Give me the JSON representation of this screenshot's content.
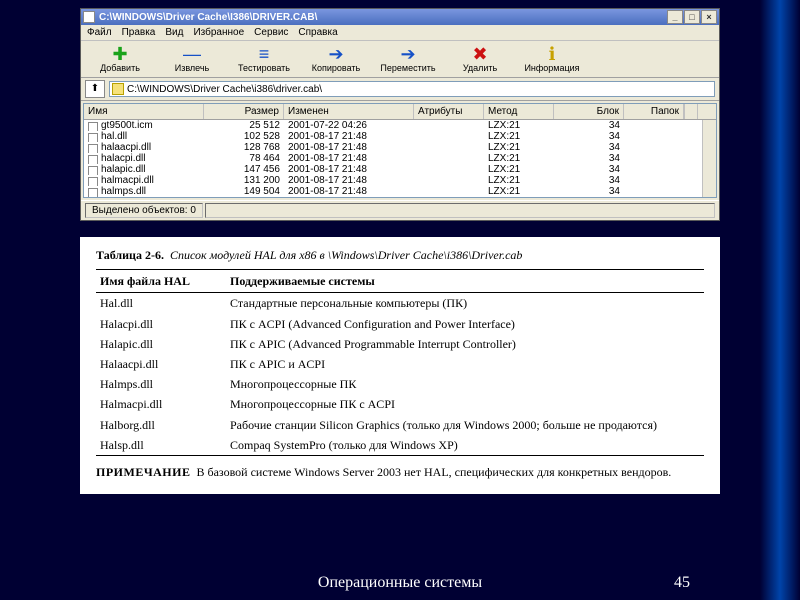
{
  "window": {
    "title": "C:\\WINDOWS\\Driver Cache\\I386\\DRIVER.CAB\\",
    "minimize": "_",
    "maximize": "□",
    "close": "×"
  },
  "menu": {
    "file": "Файл",
    "edit": "Правка",
    "view": "Вид",
    "favorites": "Избранное",
    "service": "Сервис",
    "help": "Справка"
  },
  "toolbar": {
    "add": {
      "label": "Добавить",
      "glyph": "✚",
      "color": "#1aa21a"
    },
    "extract": {
      "label": "Извлечь",
      "glyph": "—",
      "color": "#1651c7"
    },
    "test": {
      "label": "Тестировать",
      "glyph": "≡",
      "color": "#1651c7"
    },
    "copy": {
      "label": "Копировать",
      "glyph": "➔",
      "color": "#1651c7"
    },
    "move": {
      "label": "Переместить",
      "glyph": "➔",
      "color": "#1651c7"
    },
    "delete": {
      "label": "Удалить",
      "glyph": "✖",
      "color": "#cc1111"
    },
    "info": {
      "label": "Информация",
      "glyph": "ℹ",
      "color": "#c7a100"
    }
  },
  "address": {
    "up": "⬆",
    "path": "C:\\WINDOWS\\Driver Cache\\i386\\driver.cab\\"
  },
  "columns": {
    "name": "Имя",
    "size": "Размер",
    "modified": "Изменен",
    "attrs": "Атрибуты",
    "method": "Метод",
    "block": "Блок",
    "folders": "Папок"
  },
  "files": [
    {
      "name": "gt9500t.icm",
      "size": "25 512",
      "date": "2001-07-22 04:26",
      "attr": "",
      "method": "LZX:21",
      "block": "34",
      "fold": ""
    },
    {
      "name": "hal.dll",
      "size": "102 528",
      "date": "2001-08-17 21:48",
      "attr": "",
      "method": "LZX:21",
      "block": "34",
      "fold": ""
    },
    {
      "name": "halaacpi.dll",
      "size": "128 768",
      "date": "2001-08-17 21:48",
      "attr": "",
      "method": "LZX:21",
      "block": "34",
      "fold": ""
    },
    {
      "name": "halacpi.dll",
      "size": "78 464",
      "date": "2001-08-17 21:48",
      "attr": "",
      "method": "LZX:21",
      "block": "34",
      "fold": ""
    },
    {
      "name": "halapic.dll",
      "size": "147 456",
      "date": "2001-08-17 21:48",
      "attr": "",
      "method": "LZX:21",
      "block": "34",
      "fold": ""
    },
    {
      "name": "halmacpi.dll",
      "size": "131 200",
      "date": "2001-08-17 21:48",
      "attr": "",
      "method": "LZX:21",
      "block": "34",
      "fold": ""
    },
    {
      "name": "halmps.dll",
      "size": "149 504",
      "date": "2001-08-17 21:48",
      "attr": "",
      "method": "LZX:21",
      "block": "34",
      "fold": ""
    }
  ],
  "status": {
    "selected": "Выделено объектов: 0"
  },
  "book": {
    "caption_label": "Таблица 2-6.",
    "caption_text": "Список модулей HAL для x86 в \\Windows\\Driver Cache\\i386\\Driver.cab",
    "col_filename": "Имя файла HAL",
    "col_systems": "Поддерживаемые системы",
    "rows": [
      {
        "f": "Hal.dll",
        "d": "Стандартные персональные компьютеры (ПК)"
      },
      {
        "f": "Halacpi.dll",
        "d": "ПК с ACPI (Advanced Configuration and Power Interface)"
      },
      {
        "f": "Halapic.dll",
        "d": "ПК с APIC (Advanced Programmable Interrupt Controller)"
      },
      {
        "f": "Halaacpi.dll",
        "d": "ПК с APIC и ACPI"
      },
      {
        "f": "Halmps.dll",
        "d": "Многопроцессорные ПК"
      },
      {
        "f": "Halmacpi.dll",
        "d": "Многопроцессорные ПК с ACPI"
      },
      {
        "f": "Halborg.dll",
        "d": "Рабочие станции Silicon Graphics (только для Windows 2000; больше не продаются)"
      },
      {
        "f": "Halsp.dll",
        "d": "Compaq SystemPro (только для Windows XP)"
      }
    ],
    "note_label": "ПРИМЕЧАНИЕ",
    "note_text": "В базовой системе Windows Server 2003 нет HAL, специфических для конкретных вендоров."
  },
  "footer": {
    "caption": "Операционные системы",
    "page": "45"
  }
}
